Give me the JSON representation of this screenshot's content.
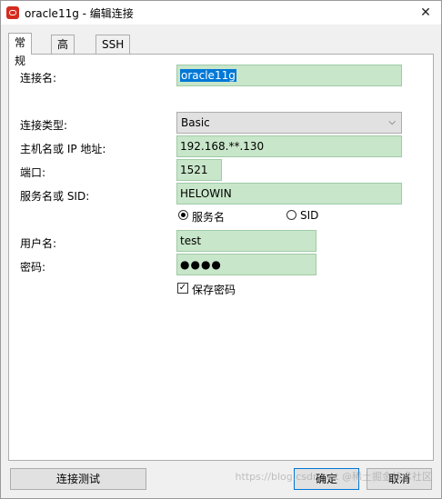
{
  "window": {
    "title": "oracle11g - 编辑连接",
    "close_glyph": "✕"
  },
  "tabs": [
    {
      "label": "常规",
      "active": true
    },
    {
      "label": "高级",
      "active": false
    },
    {
      "label": "SSH",
      "active": false
    }
  ],
  "form": {
    "connection_name_label": "连接名:",
    "connection_name_value": "oracle11g",
    "connection_type_label": "连接类型:",
    "connection_type_value": "Basic",
    "host_label": "主机名或 IP 地址:",
    "host_value": "192.168.**.130",
    "port_label": "端口:",
    "port_value": "1521",
    "service_label": "服务名或 SID:",
    "service_value": "HELOWIN",
    "radio_service_name_label": "服务名",
    "radio_sid_label": "SID",
    "username_label": "用户名:",
    "username_value": "test",
    "password_label": "密码:",
    "password_value": "●●●●",
    "save_password_label": "保存密码",
    "save_password_checked_glyph": "✓"
  },
  "buttons": {
    "test_connection": "连接测试",
    "ok": "确定",
    "cancel": "取消"
  },
  "watermark": "https://blog.csdn.net @稀土掘金技术社区",
  "colors": {
    "field_bg": "#c8e6c9",
    "selection_blue": "#0078d7",
    "oracle_red": "#d52b1e"
  }
}
